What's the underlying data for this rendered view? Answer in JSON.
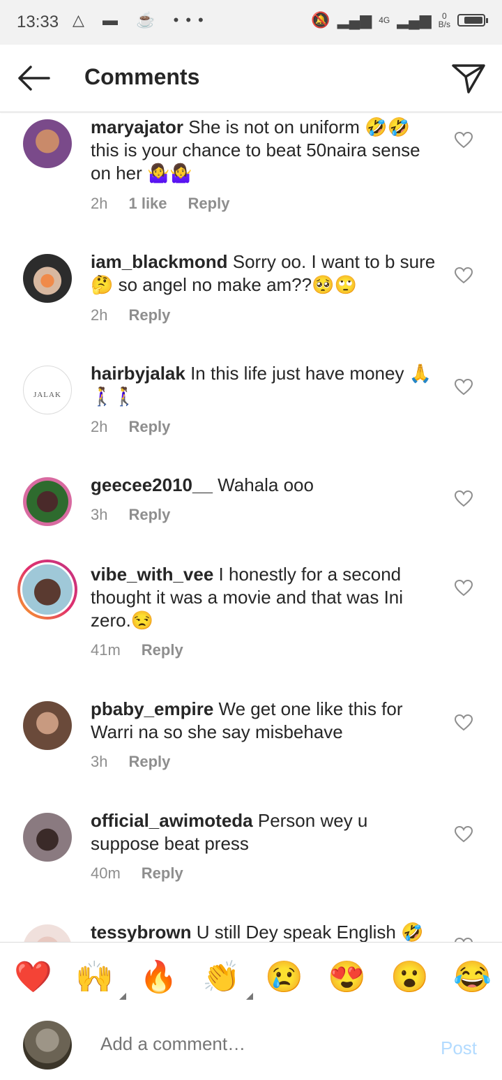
{
  "status_bar": {
    "time": "13:33",
    "left_icons": "△ ▬ ☕ •••",
    "network_type": "4G",
    "data_speed_value": "0",
    "data_speed_unit": "B/s"
  },
  "header": {
    "title": "Comments"
  },
  "comments": [
    {
      "username": "maryajator",
      "text": " She is not on uniform 🤣🤣this is your chance to beat 50naira sense on her 🤷‍♀️🤷‍♀️",
      "time": "2h",
      "likes": "1 like",
      "reply": "Reply"
    },
    {
      "username": "iam_blackmond",
      "text": " Sorry oo. I want to b sure🤔 so angel no make am??🥺🙄",
      "time": "2h",
      "reply": "Reply"
    },
    {
      "username": "hairbyjalak",
      "text": " In this life just have money 🙏🚶‍♀️🚶‍♀️",
      "time": "2h",
      "reply": "Reply",
      "avatar_logo": "JALAK"
    },
    {
      "username": "geecee2010__",
      "text": " Wahala ooo",
      "time": "3h",
      "reply": "Reply"
    },
    {
      "username": "vibe_with_vee",
      "text": " I honestly for a second thought it was a movie and that was Ini zero.😒",
      "time": "41m",
      "reply": "Reply"
    },
    {
      "username": "pbaby_empire",
      "text": " We get one like this for Warri na so she say misbehave",
      "time": "3h",
      "reply": "Reply"
    },
    {
      "username": "official_awimoteda",
      "text": " Person wey u suppose beat press",
      "time": "40m",
      "reply": "Reply"
    },
    {
      "username": "tessybrown",
      "text": " U still Dey speak English 🤣",
      "time": "",
      "reply": ""
    }
  ],
  "reactions": [
    "❤️",
    "🙌",
    "🔥",
    "👏",
    "😢",
    "😍",
    "😮",
    "😂"
  ],
  "composer": {
    "placeholder": "Add a comment…",
    "post_label": "Post"
  },
  "colors": {
    "text": "#262626",
    "secondary": "#8e8e8e",
    "post_disabled": "#b3dbff",
    "divider": "#dbdbdb"
  }
}
